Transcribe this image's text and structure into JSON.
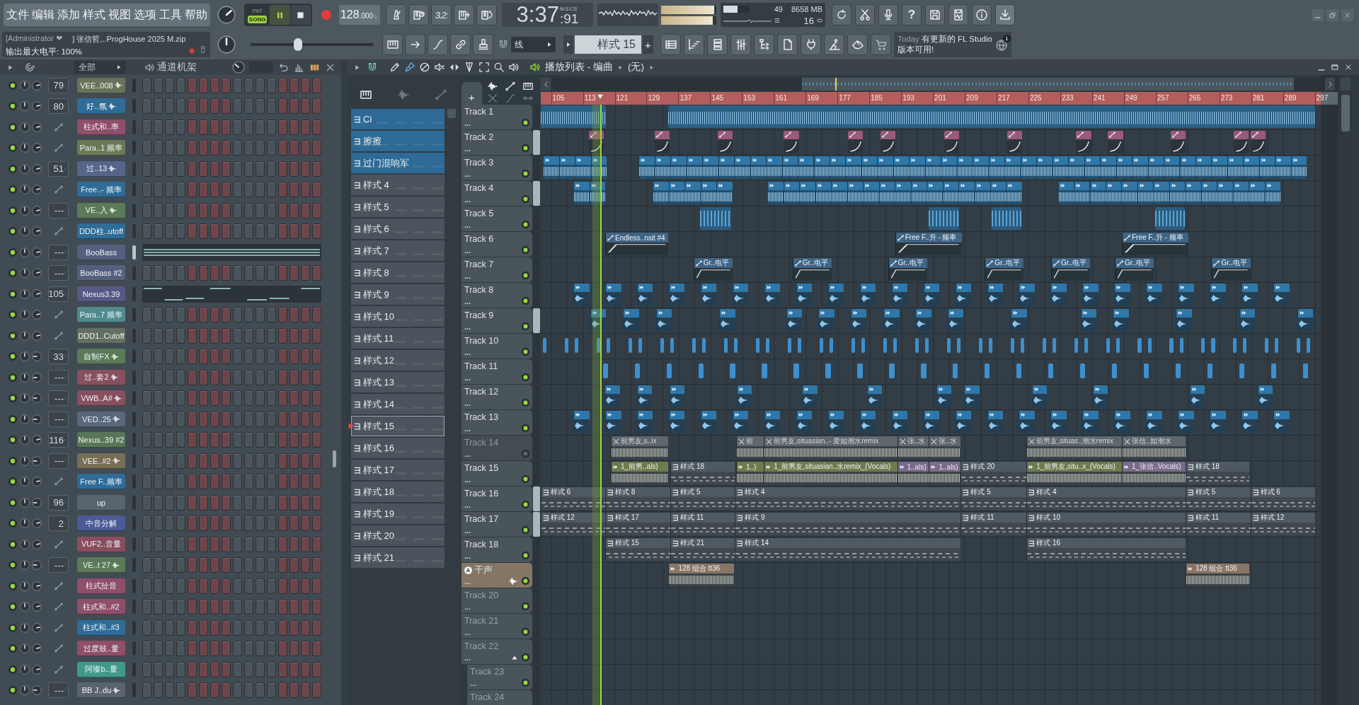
{
  "menu": [
    "文件",
    "编辑",
    "添加",
    "样式",
    "视图",
    "选项",
    "工具",
    "帮助"
  ],
  "hint": {
    "user": "[Administrator ❤",
    "file": "] 张信哲,..ProgHouse 2025 M.zip",
    "message": "输出最大电平: 100%"
  },
  "transport": {
    "modes": [
      {
        "label": "PAT",
        "selected": false
      },
      {
        "label": "SONG",
        "selected": true
      }
    ],
    "playing": true,
    "tempo": "128",
    "tempo_decimals": ".000",
    "song_position": {
      "level": 0.39
    }
  },
  "countdown": "3.2:",
  "clock": {
    "unit": "M:S:CS",
    "time": "3:37",
    "centiseconds": ":91"
  },
  "output_meter": [
    {
      "level": 0.96
    },
    {
      "level": 0.93
    }
  ],
  "cpu": {
    "level": 0.55,
    "polyphony": "49",
    "memory": "8658 MB",
    "voices": "16"
  },
  "help": "?",
  "snap": "线",
  "pattern_picker": {
    "name": "样式 15",
    "add": "+"
  },
  "news": {
    "date": "Today",
    "text": "有更新的 FL Studio 版本可用!",
    "count": "1"
  },
  "channel_rack": {
    "filter": "全部",
    "title": "通道机架",
    "channels": [
      {
        "name": "VEE..008",
        "color": "#68735a",
        "kind": "audio",
        "target": "79",
        "enabled": true,
        "selected": false,
        "piano_roll": false,
        "volume_low": false
      },
      {
        "name": "好..氛",
        "color": "#2f6c97",
        "kind": "audio",
        "target": "80",
        "enabled": true,
        "selected": false,
        "piano_roll": false,
        "volume_low": false
      },
      {
        "name": "柱式和..率",
        "color": "#8f4e69",
        "kind": "automation",
        "enabled": true,
        "selected": false,
        "piano_roll": false,
        "volume_low": false
      },
      {
        "name": "Para..1 频率",
        "color": "#6a7a57",
        "kind": "automation",
        "enabled": true,
        "selected": false,
        "piano_roll": false,
        "volume_low": false
      },
      {
        "name": "过..13",
        "color": "#56658a",
        "kind": "audio",
        "target": "51",
        "enabled": true,
        "selected": false,
        "piano_roll": false,
        "volume_low": false
      },
      {
        "name": "Free..- 频率",
        "color": "#2f6c97",
        "kind": "automation",
        "enabled": true,
        "selected": false,
        "piano_roll": false,
        "volume_low": false
      },
      {
        "name": "VE..入",
        "color": "#5b7a58",
        "kind": "audio",
        "target": "---",
        "enabled": true,
        "selected": false,
        "piano_roll": false,
        "volume_low": false
      },
      {
        "name": "DDD柱..utoff",
        "color": "#2f6c97",
        "kind": "automation",
        "enabled": true,
        "selected": false,
        "piano_roll": false,
        "volume_low": false
      },
      {
        "name": "BooBass",
        "color": "#55607f",
        "kind": "synth",
        "target": "---",
        "enabled": true,
        "selected": true,
        "piano_roll": true,
        "volume_low": false
      },
      {
        "name": "BooBass #2",
        "color": "#55607f",
        "kind": "synth",
        "target": "---",
        "enabled": true,
        "selected": false,
        "piano_roll": false,
        "volume_low": false
      },
      {
        "name": "Nexus3.39",
        "color": "#585887",
        "kind": "synth",
        "target": "105",
        "enabled": true,
        "selected": false,
        "piano_roll": true,
        "volume_low": false
      },
      {
        "name": "Para..7 频率",
        "color": "#4f8b8e",
        "kind": "automation",
        "enabled": true,
        "selected": false,
        "piano_roll": false,
        "volume_low": false
      },
      {
        "name": "DDD1..Cutoff",
        "color": "#627060",
        "kind": "automation",
        "enabled": true,
        "selected": false,
        "piano_roll": false,
        "volume_low": false
      },
      {
        "name": "自制FX",
        "color": "#5b7a58",
        "kind": "audio",
        "target": "33",
        "enabled": true,
        "selected": false,
        "piano_roll": false,
        "volume_low": true
      },
      {
        "name": "过..套2",
        "color": "#87505f",
        "kind": "audio",
        "target": "---",
        "enabled": true,
        "selected": false,
        "piano_roll": false,
        "volume_low": true
      },
      {
        "name": "VWB..A#",
        "color": "#87505f",
        "kind": "audio",
        "target": "---",
        "enabled": true,
        "selected": false,
        "piano_roll": false,
        "volume_low": true
      },
      {
        "name": "VED..25",
        "color": "#58677a",
        "kind": "audio",
        "target": "---",
        "enabled": true,
        "selected": false,
        "piano_roll": false,
        "volume_low": true
      },
      {
        "name": "Nexus..39 #2",
        "color": "#577655",
        "kind": "synth",
        "target": "116",
        "enabled": true,
        "selected": false,
        "piano_roll": false,
        "volume_low": false
      },
      {
        "name": "VEE..#2",
        "color": "#786d55",
        "kind": "audio",
        "target": "---",
        "enabled": true,
        "selected": false,
        "piano_roll": false,
        "volume_low": true
      },
      {
        "name": "Free F..频率",
        "color": "#2f6c97",
        "kind": "automation",
        "enabled": true,
        "selected": false,
        "piano_roll": false,
        "volume_low": false
      },
      {
        "name": "up",
        "color": "#59646f",
        "kind": "synth",
        "target": "96",
        "enabled": true,
        "selected": false,
        "piano_roll": false,
        "volume_low": true
      },
      {
        "name": "中音分解",
        "color": "#4c5a96",
        "kind": "synth",
        "target": "2",
        "enabled": true,
        "selected": false,
        "piano_roll": false,
        "volume_low": false
      },
      {
        "name": "VUF2..音量",
        "color": "#8a4d5e",
        "kind": "automation",
        "enabled": true,
        "selected": false,
        "piano_roll": false,
        "volume_low": false
      },
      {
        "name": "VE..t 27",
        "color": "#5b7a58",
        "kind": "audio",
        "target": "---",
        "enabled": true,
        "selected": false,
        "piano_roll": false,
        "volume_low": true
      },
      {
        "name": "柱式扯音",
        "color": "#8f4e69",
        "kind": "automation",
        "enabled": true,
        "selected": false,
        "piano_roll": false,
        "volume_low": false
      },
      {
        "name": "柱式和..#2",
        "color": "#8f4e69",
        "kind": "automation",
        "enabled": true,
        "selected": false,
        "piano_roll": false,
        "volume_low": false
      },
      {
        "name": "柱式和..#3",
        "color": "#2f6c97",
        "kind": "automation",
        "enabled": true,
        "selected": false,
        "piano_roll": false,
        "volume_low": false
      },
      {
        "name": "过度鼓..量",
        "color": "#8f4e69",
        "kind": "automation",
        "enabled": true,
        "selected": false,
        "piano_roll": false,
        "volume_low": false
      },
      {
        "name": "阿璨b..量",
        "color": "#3f9a8c",
        "kind": "automation",
        "enabled": true,
        "selected": false,
        "piano_roll": false,
        "volume_low": false
      },
      {
        "name": "BB J..du",
        "color": "#59646f",
        "kind": "audio",
        "target": "---",
        "enabled": true,
        "selected": false,
        "piano_roll": false,
        "volume_low": true
      }
    ]
  },
  "playlist": {
    "title": "播放列表 - 编曲",
    "arrangement": "(无)",
    "add": "+",
    "patterns": [
      {
        "name": "Ci",
        "color": "#2e6a95",
        "selected": false
      },
      {
        "name": "擦擦",
        "color": "#2e6a95",
        "selected": false
      },
      {
        "name": "过门混响军",
        "color": "#2e6a95",
        "selected": false
      },
      {
        "name": "样式 4",
        "color": "#4b545c",
        "selected": false
      },
      {
        "name": "样式 5",
        "color": "#4b545c",
        "selected": false
      },
      {
        "name": "样式 6",
        "color": "#4b545c",
        "selected": false
      },
      {
        "name": "样式 7",
        "color": "#4b545c",
        "selected": false
      },
      {
        "name": "样式 8",
        "color": "#4b545c",
        "selected": false
      },
      {
        "name": "样式 9",
        "color": "#4b545c",
        "selected": false
      },
      {
        "name": "样式 10",
        "color": "#4b545c",
        "selected": false
      },
      {
        "name": "样式 11",
        "color": "#4b545c",
        "selected": false
      },
      {
        "name": "样式 12",
        "color": "#4b545c",
        "selected": false
      },
      {
        "name": "样式 13",
        "color": "#4b545c",
        "selected": false
      },
      {
        "name": "样式 14",
        "color": "#4b545c",
        "selected": false
      },
      {
        "name": "样式 15",
        "color": "#4b545c",
        "selected": true
      },
      {
        "name": "样式 16",
        "color": "#4b545c",
        "selected": false
      },
      {
        "name": "样式 17",
        "color": "#4b545c",
        "selected": false
      },
      {
        "name": "样式 18",
        "color": "#4b545c",
        "selected": false
      },
      {
        "name": "样式 19",
        "color": "#4b545c",
        "selected": false
      },
      {
        "name": "样式 20",
        "color": "#4b545c",
        "selected": false
      },
      {
        "name": "样式 21",
        "color": "#4b545c",
        "selected": false
      }
    ],
    "ruler": [
      "105",
      "113",
      "121",
      "129",
      "137",
      "145",
      "153",
      "161",
      "169",
      "177",
      "185",
      "193",
      "201",
      "209",
      "217",
      "225",
      "233",
      "241",
      "249",
      "257",
      "265",
      "273",
      "281",
      "289",
      "297"
    ],
    "tracks": [
      {
        "name": "Track 1",
        "more": "...",
        "kind": "plain",
        "enabled": true,
        "selected": false,
        "empty": false
      },
      {
        "name": "Track 2",
        "more": "...",
        "kind": "plain",
        "enabled": true,
        "selected": true,
        "empty": false
      },
      {
        "name": "Track 3",
        "more": "...",
        "kind": "plain",
        "enabled": true,
        "selected": false,
        "empty": false
      },
      {
        "name": "Track 4",
        "more": "...",
        "kind": "plain",
        "enabled": true,
        "selected": true,
        "empty": false
      },
      {
        "name": "Track 5",
        "more": "...",
        "kind": "plain",
        "enabled": true,
        "selected": false,
        "empty": false
      },
      {
        "name": "Track 6",
        "more": "...",
        "kind": "plain",
        "enabled": true,
        "selected": false,
        "empty": false,
        "clips": [
          {
            "label": "Endless..nsit #4",
            "kind": "automation",
            "color": "#3f6484",
            "muted": false
          },
          {
            "label": "Free F..升 - 频率",
            "kind": "automation",
            "color": "#3f6484",
            "muted": false
          },
          {
            "label": "Free F..升 - 频率",
            "kind": "automation",
            "color": "#3f6484",
            "muted": false
          }
        ]
      },
      {
        "name": "Track 7",
        "more": "...",
        "kind": "plain",
        "enabled": true,
        "selected": false,
        "empty": false,
        "clips": [
          {
            "label": "Gr..电平",
            "kind": "automation",
            "color": "#3f6484",
            "muted": false
          },
          {
            "label": "Gr..电平",
            "kind": "automation",
            "color": "#3f6484",
            "muted": false
          },
          {
            "label": "Gr..电平",
            "kind": "automation",
            "color": "#3f6484",
            "muted": false
          },
          {
            "label": "Gr..电平",
            "kind": "automation",
            "color": "#3f6484",
            "muted": false
          },
          {
            "label": "Gr..电平",
            "kind": "automation",
            "color": "#3f6484",
            "muted": false
          },
          {
            "label": "Gr..电平",
            "kind": "automation",
            "color": "#3f6484",
            "muted": false
          },
          {
            "label": "Gr..电平",
            "kind": "automation",
            "color": "#3f6484",
            "muted": false
          }
        ]
      },
      {
        "name": "Track 8",
        "more": "...",
        "kind": "plain",
        "enabled": true,
        "selected": false,
        "empty": false
      },
      {
        "name": "Track 9",
        "more": "...",
        "kind": "plain",
        "enabled": true,
        "selected": true,
        "empty": false
      },
      {
        "name": "Track 10",
        "more": "...",
        "kind": "plain",
        "enabled": true,
        "selected": false,
        "empty": false
      },
      {
        "name": "Track 11",
        "more": "...",
        "kind": "plain",
        "enabled": true,
        "selected": false,
        "empty": false
      },
      {
        "name": "Track 12",
        "more": "...",
        "kind": "plain",
        "enabled": true,
        "selected": false,
        "empty": false
      },
      {
        "name": "Track 13",
        "more": "...",
        "kind": "plain",
        "enabled": true,
        "selected": false,
        "empty": false
      },
      {
        "name": "Track 14",
        "more": "...",
        "kind": "plain",
        "enabled": false,
        "selected": false,
        "empty": false,
        "clips": [
          {
            "label": "前男友,s..ix",
            "kind": "audio",
            "color": "#5f676c",
            "muted": true
          },
          {
            "label": "前",
            "kind": "audio",
            "color": "#5f676c",
            "muted": true
          },
          {
            "label": "前男友,situasian..- 爱如潮水remix",
            "kind": "audio",
            "color": "#5f676c",
            "muted": true
          },
          {
            "label": "张..水",
            "kind": "audio",
            "color": "#5f676c",
            "muted": true
          },
          {
            "label": "张..水",
            "kind": "audio",
            "color": "#5f676c",
            "muted": true
          },
          {
            "label": "前男友,situas..潮水remix",
            "kind": "audio",
            "color": "#5f676c",
            "muted": true
          },
          {
            "label": "张信..如潮水",
            "kind": "audio",
            "color": "#5f676c",
            "muted": true
          }
        ]
      },
      {
        "name": "Track 15",
        "more": "...",
        "kind": "plain",
        "enabled": true,
        "selected": false,
        "empty": false,
        "clips": [
          {
            "label": "1_前男..als)",
            "kind": "audio",
            "color": "#6e7b4c",
            "muted": false
          },
          {
            "label": "样式 18",
            "kind": "pattern",
            "color": "#4f5961",
            "muted": false
          },
          {
            "label": "1..)",
            "kind": "audio",
            "color": "#6e7b4c",
            "muted": false
          },
          {
            "label": "1_前男友,situasian..水remix_(Vocals)",
            "kind": "audio",
            "color": "#6e7b4c",
            "muted": false
          },
          {
            "label": "1..als)",
            "kind": "audio",
            "color": "#7a6a8c",
            "muted": false
          },
          {
            "label": "1..als)",
            "kind": "audio",
            "color": "#7a6a8c",
            "muted": false
          },
          {
            "label": "样式 20",
            "kind": "pattern",
            "color": "#4f5961",
            "muted": false
          },
          {
            "label": "1_前男友,situ..x_(Vocals)",
            "kind": "audio",
            "color": "#6e7b4c",
            "muted": false
          },
          {
            "label": "1_张信..Vocals)",
            "kind": "audio",
            "color": "#7a6a8c",
            "muted": false
          },
          {
            "label": "样式 18",
            "kind": "pattern",
            "color": "#4f5961",
            "muted": false
          }
        ]
      },
      {
        "name": "Track 16",
        "more": "...",
        "kind": "plain",
        "enabled": true,
        "selected": true,
        "empty": false,
        "clips": [
          {
            "label": "样式 6",
            "kind": "pattern",
            "color": "#4f5961",
            "muted": false
          },
          {
            "label": "样式 8",
            "kind": "pattern",
            "color": "#4f5961",
            "muted": false
          },
          {
            "label": "样式 5",
            "kind": "pattern",
            "color": "#4f5961",
            "muted": false
          },
          {
            "label": "样式 4",
            "kind": "pattern",
            "color": "#4f5961",
            "muted": false
          },
          {
            "label": "样式 5",
            "kind": "pattern",
            "color": "#4f5961",
            "muted": false
          },
          {
            "label": "样式 4",
            "kind": "pattern",
            "color": "#4f5961",
            "muted": false
          },
          {
            "label": "样式 5",
            "kind": "pattern",
            "color": "#4f5961",
            "muted": false
          },
          {
            "label": "样式 6",
            "kind": "pattern",
            "color": "#4f5961",
            "muted": false
          }
        ]
      },
      {
        "name": "Track 17",
        "more": "...",
        "kind": "plain",
        "enabled": true,
        "selected": true,
        "empty": false,
        "clips": [
          {
            "label": "样式 12",
            "kind": "pattern",
            "color": "#4f5961",
            "muted": false
          },
          {
            "label": "样式 17",
            "kind": "pattern",
            "color": "#4f5961",
            "muted": false
          },
          {
            "label": "样式 11",
            "kind": "pattern",
            "color": "#4f5961",
            "muted": false
          },
          {
            "label": "样式 9",
            "kind": "pattern",
            "color": "#4f5961",
            "muted": false
          },
          {
            "label": "样式 11",
            "kind": "pattern",
            "color": "#4f5961",
            "muted": false
          },
          {
            "label": "样式 10",
            "kind": "pattern",
            "color": "#4f5961",
            "muted": false
          },
          {
            "label": "样式 11",
            "kind": "pattern",
            "color": "#4f5961",
            "muted": false
          },
          {
            "label": "样式 12",
            "kind": "pattern",
            "color": "#4f5961",
            "muted": false
          }
        ]
      },
      {
        "name": "Track 18",
        "more": "...",
        "kind": "plain",
        "enabled": true,
        "selected": false,
        "empty": false,
        "clips": [
          {
            "label": "样式 15",
            "kind": "pattern",
            "color": "#4f5961",
            "muted": false
          },
          {
            "label": "样式 21",
            "kind": "pattern",
            "color": "#4f5961",
            "muted": false
          },
          {
            "label": "样式 14",
            "kind": "pattern",
            "color": "#4f5961",
            "muted": false
          },
          {
            "label": "样式 16",
            "kind": "pattern",
            "color": "#4f5961",
            "muted": false
          }
        ]
      },
      {
        "name": "干声",
        "badge": "A",
        "color": "#857565",
        "more": "...",
        "kind": "audio",
        "enabled": true,
        "selected": false,
        "empty": false,
        "clips": [
          {
            "label": "128 组合 tt36",
            "kind": "audio",
            "color": "#8a7464",
            "muted": false
          },
          {
            "label": "128 组合 tt36",
            "kind": "audio",
            "color": "#8a7464",
            "muted": false
          }
        ]
      },
      {
        "name": "Track 20",
        "more": "...",
        "kind": "plain",
        "enabled": true,
        "selected": false,
        "empty": true
      },
      {
        "name": "Track 21",
        "more": "...",
        "kind": "plain",
        "enabled": true,
        "selected": false,
        "empty": true
      },
      {
        "name": "Track 22",
        "more": "...",
        "kind": "plain",
        "enabled": true,
        "selected": false,
        "empty": true,
        "expanded": true,
        "children": [
          {
            "name": "Track 23",
            "more": "...",
            "enabled": true,
            "selected": false,
            "empty": true
          },
          {
            "name": "Track 24",
            "selected": false,
            "empty": true
          }
        ]
      }
    ]
  }
}
